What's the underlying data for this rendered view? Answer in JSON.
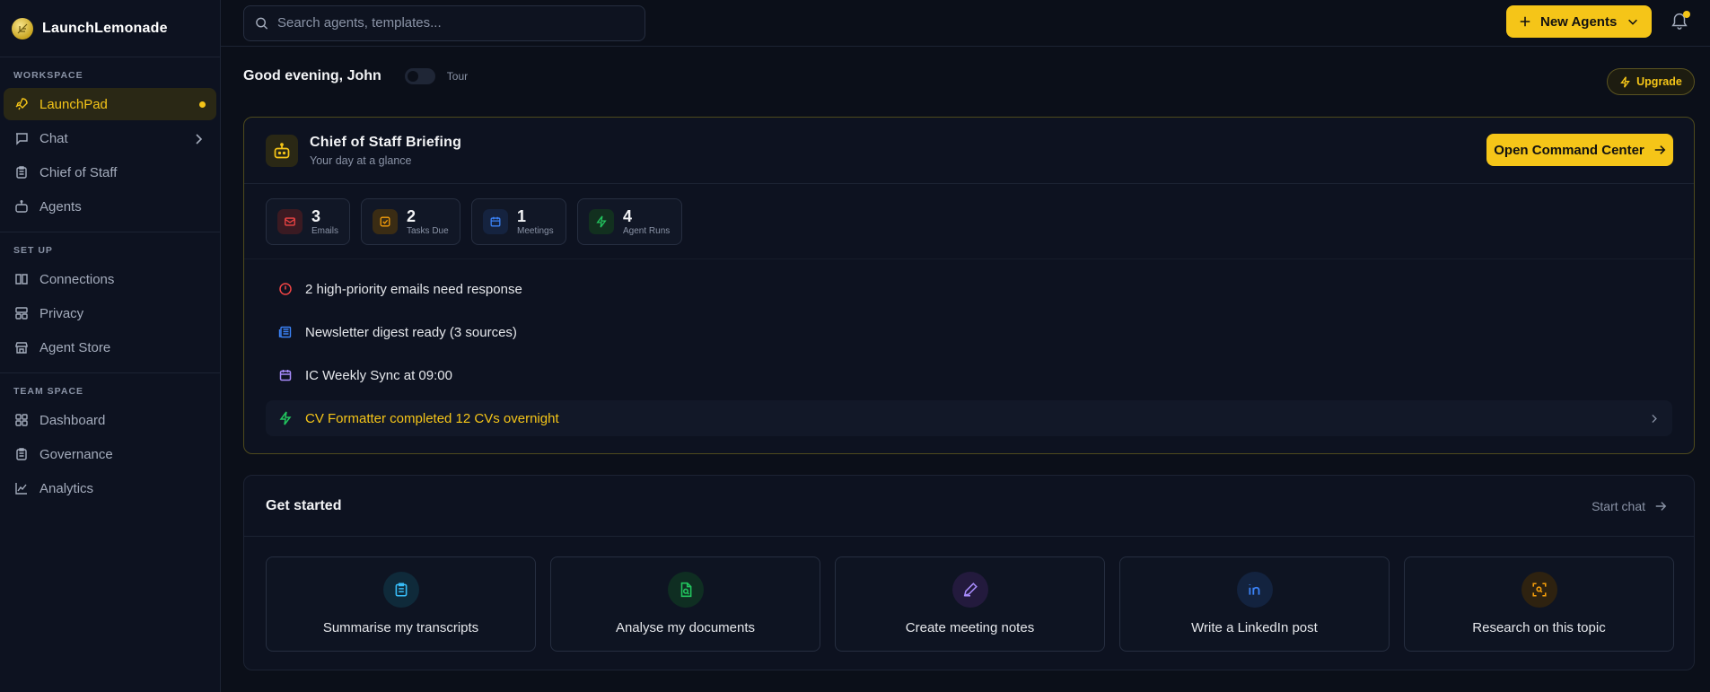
{
  "brand": {
    "name": "LaunchLemonade"
  },
  "sidebar": {
    "sections": [
      {
        "title": "WORKSPACE",
        "items": [
          {
            "label": "LaunchPad",
            "icon": "rocket-icon",
            "active": true
          },
          {
            "label": "Chat",
            "icon": "chat-icon"
          },
          {
            "label": "Chief of Staff",
            "icon": "clipboard-icon"
          },
          {
            "label": "Agents",
            "icon": "bot-icon"
          }
        ]
      },
      {
        "title": "SET UP",
        "items": [
          {
            "label": "Connections",
            "icon": "book-icon"
          },
          {
            "label": "Privacy",
            "icon": "layers-icon"
          },
          {
            "label": "Agent Store",
            "icon": "store-icon"
          }
        ]
      },
      {
        "title": "TEAM SPACE",
        "items": [
          {
            "label": "Dashboard",
            "icon": "grid-icon"
          },
          {
            "label": "Governance",
            "icon": "clipboard-icon"
          },
          {
            "label": "Analytics",
            "icon": "chart-icon"
          }
        ]
      }
    ]
  },
  "topbar": {
    "search_placeholder": "Search agents, templates...",
    "new_agents_label": "New Agents"
  },
  "greeting": "Good evening, John",
  "tour_label": "Tour",
  "upgrade_label": "Upgrade",
  "briefing": {
    "title": "Chief of Staff Briefing",
    "subtitle": "Your day at a glance",
    "command_button": "Open Command Center",
    "stats": [
      {
        "value": "3",
        "label": "Emails",
        "icon": "mail-icon",
        "color": "#ef4444"
      },
      {
        "value": "2",
        "label": "Tasks Due",
        "icon": "task-icon",
        "color": "#f59e0b"
      },
      {
        "value": "1",
        "label": "Meetings",
        "icon": "calendar-icon",
        "color": "#3b82f6"
      },
      {
        "value": "4",
        "label": "Agent Runs",
        "icon": "bolt-icon",
        "color": "#22c55e"
      }
    ],
    "items": [
      {
        "text": "2 high-priority emails need response",
        "icon": "alert-icon"
      },
      {
        "text": "Newsletter digest ready (3 sources)",
        "icon": "newspaper-icon"
      },
      {
        "text": "IC Weekly Sync at 09:00",
        "icon": "calendar-icon"
      },
      {
        "text": "CV Formatter completed 12 CVs overnight",
        "icon": "bolt-icon"
      }
    ]
  },
  "get_started": {
    "title": "Get started",
    "start_chat": "Start chat",
    "cards": [
      {
        "label": "Summarise my transcripts",
        "icon": "clipboard-icon",
        "color": "#38bdf8"
      },
      {
        "label": "Analyse my documents",
        "icon": "file-search-icon",
        "color": "#22c55e"
      },
      {
        "label": "Create meeting notes",
        "icon": "pen-icon",
        "color": "#a78bfa"
      },
      {
        "label": "Write a LinkedIn post",
        "icon": "linkedin-icon",
        "color": "#3b82f6"
      },
      {
        "label": "Research on this topic",
        "icon": "scan-icon",
        "color": "#f59e0b"
      }
    ]
  }
}
